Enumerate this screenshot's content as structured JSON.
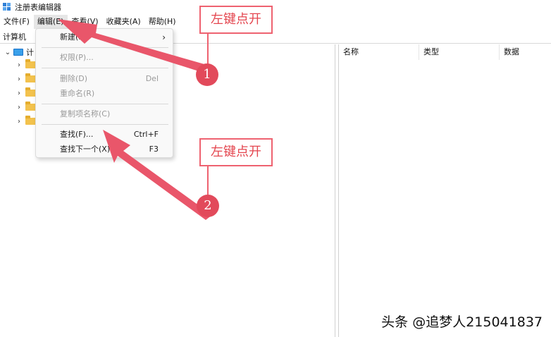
{
  "window": {
    "title": "注册表编辑器"
  },
  "menubar": {
    "items": [
      "文件(F)",
      "编辑(E)",
      "查看(V)",
      "收藏夹(A)",
      "帮助(H)"
    ]
  },
  "address": {
    "path": "计算机"
  },
  "tree": {
    "root_label": "计",
    "child_count": 5
  },
  "list": {
    "columns": [
      "名称",
      "类型",
      "数据"
    ]
  },
  "edit_menu": {
    "items": [
      {
        "label": "新建(N)",
        "shortcut": "",
        "submenu": true,
        "disabled": false
      },
      {
        "label": "权限(P)...",
        "shortcut": "",
        "disabled": true
      },
      {
        "label": "删除(D)",
        "shortcut": "Del",
        "disabled": true
      },
      {
        "label": "重命名(R)",
        "shortcut": "",
        "disabled": true
      },
      {
        "label": "复制项名称(C)",
        "shortcut": "",
        "disabled": true
      },
      {
        "label": "查找(F)...",
        "shortcut": "Ctrl+F",
        "disabled": false
      },
      {
        "label": "查找下一个(X)",
        "shortcut": "F3",
        "disabled": false
      }
    ]
  },
  "annotations": {
    "callout1": "左键点开",
    "callout2": "左键点开",
    "badge1": "1",
    "badge2": "2",
    "color": "#e24a5b"
  },
  "watermark": "头条 @追梦人215041837"
}
